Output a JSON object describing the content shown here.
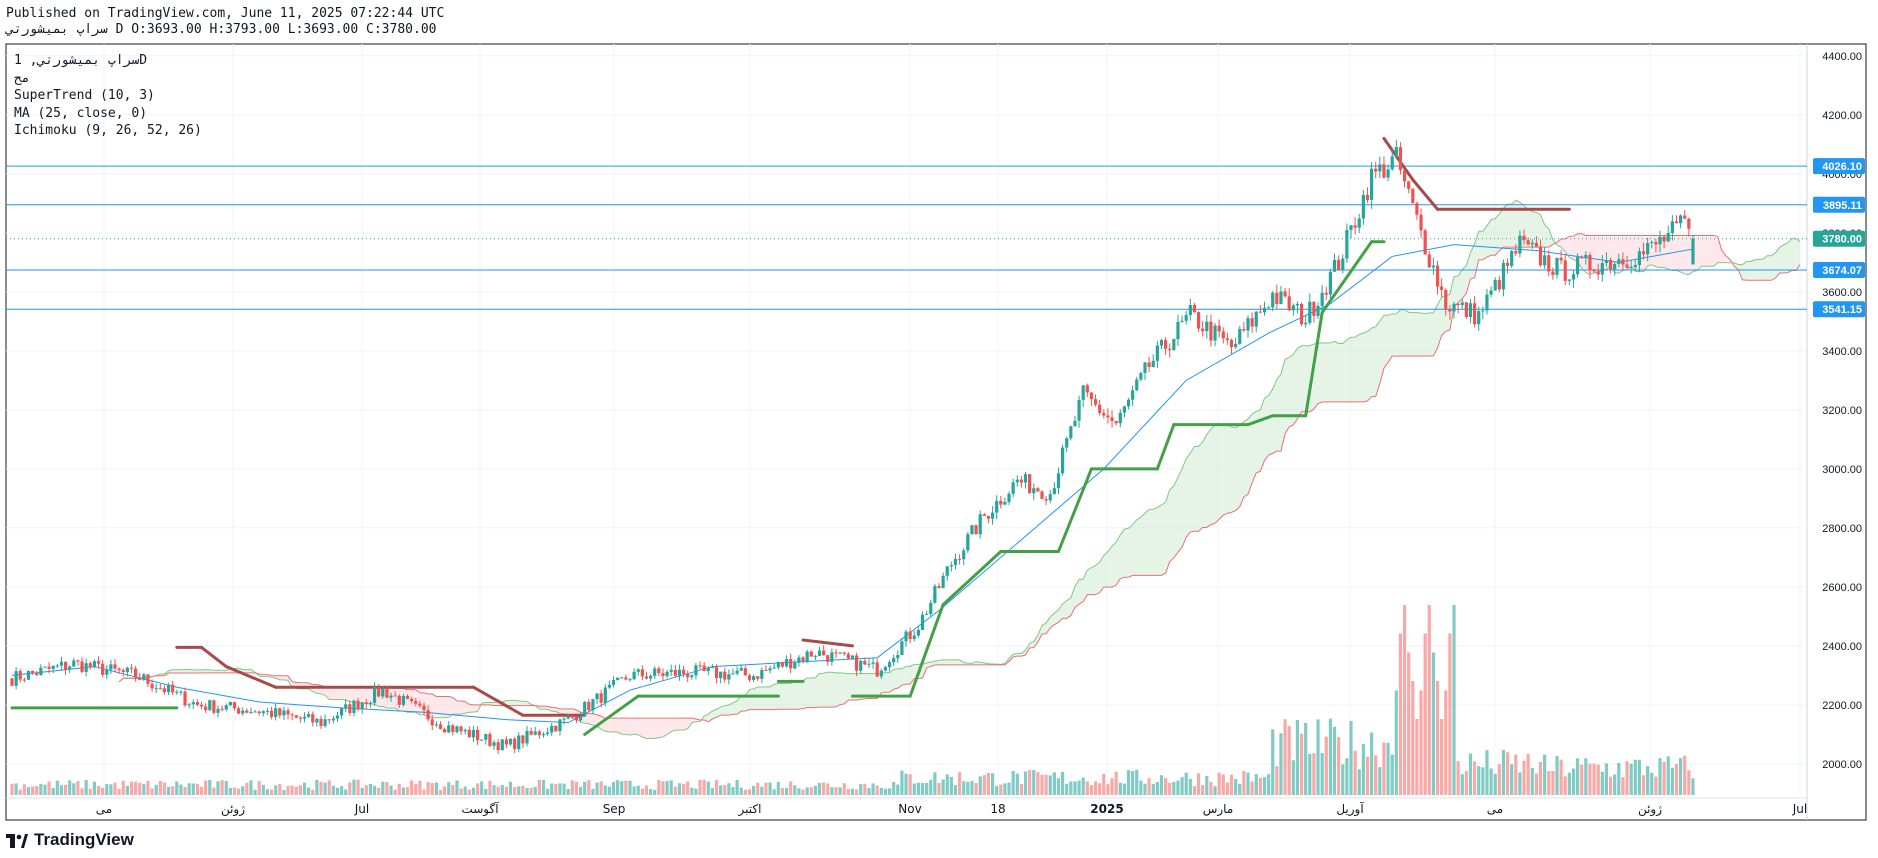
{
  "header": {
    "published": "Published on TradingView.com, June 11, 2025 07:22:44 UTC",
    "ohlc": "سراپ بمیشورتي D O:3693.00 H:3793.00 L:3693.00 C:3780.00"
  },
  "legend": {
    "symbol": "سراپ بمیشورتي, 1D",
    "exchange": "مح",
    "indicators": [
      "SuperTrend (10, 3)",
      "MA (25, close, 0)",
      "Ichimoku (9, 26, 52, 26)"
    ]
  },
  "brand": "TradingView",
  "colors": {
    "up": "#26a69a",
    "down": "#ef5350",
    "supertrend_up": "#43a047",
    "supertrend_down": "#a84a4a",
    "ma": "#2196f3",
    "cloud_bull": "#c8e6c9",
    "cloud_bear": "#ffcdd2",
    "hline": "#2196f3",
    "price_label": "#26a69a"
  },
  "chart_data": {
    "type": "candlestick",
    "y_axis": {
      "min": 1810,
      "max": 4440,
      "ticks": [
        2000,
        2200,
        2400,
        2600,
        2800,
        3000,
        3200,
        3400,
        3600,
        3800,
        4000,
        4200,
        4400
      ],
      "tick_labels": [
        "2000.00",
        "2200.00",
        "2400.00",
        "2600.00",
        "2800.00",
        "3000.00",
        "3200.00",
        "3400.00",
        "3600.00",
        "3800.00",
        "4000.00",
        "4200.00",
        "4400.00"
      ]
    },
    "x_axis": {
      "labels": [
        "می",
        "ژوئن",
        "Jul",
        "آگوست",
        "Sep",
        "اکتبر",
        "Nov",
        "18",
        "2025",
        "مارس",
        "آوریل",
        "می",
        "ژوئن",
        "Jul"
      ]
    },
    "horizontal_lines": [
      {
        "value": 4026.1,
        "label": "4026.10"
      },
      {
        "value": 3895.11,
        "label": "3895.11"
      },
      {
        "value": 3674.07,
        "label": "3674.07"
      },
      {
        "value": 3541.15,
        "label": "3541.15"
      }
    ],
    "last_price": {
      "value": 3780.0,
      "label": "3780.00"
    },
    "ohlc_last": {
      "open": 3693.0,
      "high": 3793.0,
      "low": 3693.0,
      "close": 3780.0
    },
    "close_path": [
      [
        0,
        2290
      ],
      [
        15,
        2340
      ],
      [
        30,
        2300
      ],
      [
        45,
        2200
      ],
      [
        60,
        2180
      ],
      [
        75,
        2140
      ],
      [
        90,
        2250
      ],
      [
        105,
        2130
      ],
      [
        120,
        2060
      ],
      [
        135,
        2150
      ],
      [
        150,
        2300
      ],
      [
        165,
        2310
      ],
      [
        180,
        2300
      ],
      [
        195,
        2380
      ],
      [
        210,
        2320
      ],
      [
        220,
        2470
      ],
      [
        228,
        2680
      ],
      [
        236,
        2840
      ],
      [
        244,
        2960
      ],
      [
        252,
        2920
      ],
      [
        260,
        3250
      ],
      [
        268,
        3150
      ],
      [
        276,
        3350
      ],
      [
        286,
        3520
      ],
      [
        296,
        3410
      ],
      [
        306,
        3590
      ],
      [
        314,
        3510
      ],
      [
        322,
        3700
      ],
      [
        330,
        3990
      ],
      [
        336,
        4050
      ],
      [
        342,
        3800
      ],
      [
        348,
        3560
      ],
      [
        356,
        3520
      ],
      [
        366,
        3760
      ],
      [
        376,
        3670
      ],
      [
        386,
        3700
      ],
      [
        396,
        3730
      ],
      [
        406,
        3830
      ],
      [
        408,
        3780
      ]
    ],
    "volume": [
      {
        "range": [
          0,
          215
        ],
        "level": 0.06
      },
      {
        "range": [
          216,
          305
        ],
        "level": 0.1
      },
      {
        "range": [
          306,
          335
        ],
        "level": 0.3
      },
      {
        "range": [
          336,
          350
        ],
        "level": 1.0
      },
      {
        "range": [
          351,
          370
        ],
        "level": 0.18
      },
      {
        "range": [
          371,
          408
        ],
        "level": 0.16
      }
    ],
    "supertrend": [
      [
        0,
        2190,
        "up"
      ],
      [
        40,
        2190,
        "up"
      ],
      [
        40,
        2395,
        "down"
      ],
      [
        46,
        2395,
        "down"
      ],
      [
        52,
        2330,
        "down"
      ],
      [
        64,
        2260,
        "down"
      ],
      [
        112,
        2260,
        "down"
      ],
      [
        124,
        2165,
        "down"
      ],
      [
        139,
        2165,
        "down"
      ],
      [
        139,
        2100,
        "up"
      ],
      [
        152,
        2230,
        "up"
      ],
      [
        186,
        2230,
        "up"
      ],
      [
        186,
        2280,
        "up"
      ],
      [
        192,
        2280,
        "up"
      ],
      [
        192,
        2420,
        "down"
      ],
      [
        204,
        2400,
        "down"
      ],
      [
        204,
        2230,
        "up"
      ],
      [
        218,
        2230,
        "up"
      ],
      [
        226,
        2540,
        "up"
      ],
      [
        240,
        2720,
        "up"
      ],
      [
        254,
        2720,
        "up"
      ],
      [
        262,
        3000,
        "up"
      ],
      [
        278,
        3000,
        "up"
      ],
      [
        282,
        3150,
        "up"
      ],
      [
        300,
        3150,
        "up"
      ],
      [
        306,
        3180,
        "up"
      ],
      [
        314,
        3180,
        "up"
      ],
      [
        318,
        3530,
        "up"
      ],
      [
        330,
        3770,
        "up"
      ],
      [
        333,
        3770,
        "up"
      ],
      [
        333,
        4120,
        "down"
      ],
      [
        340,
        3980,
        "down"
      ],
      [
        346,
        3880,
        "down"
      ],
      [
        378,
        3880,
        "down"
      ]
    ],
    "ma_path": [
      [
        0,
        2300
      ],
      [
        20,
        2330
      ],
      [
        40,
        2260
      ],
      [
        60,
        2210
      ],
      [
        80,
        2190
      ],
      [
        100,
        2175
      ],
      [
        120,
        2150
      ],
      [
        135,
        2140
      ],
      [
        150,
        2250
      ],
      [
        170,
        2330
      ],
      [
        190,
        2345
      ],
      [
        210,
        2360
      ],
      [
        225,
        2520
      ],
      [
        245,
        2760
      ],
      [
        265,
        3000
      ],
      [
        285,
        3300
      ],
      [
        305,
        3460
      ],
      [
        320,
        3560
      ],
      [
        335,
        3720
      ],
      [
        350,
        3760
      ],
      [
        370,
        3740
      ],
      [
        390,
        3700
      ],
      [
        408,
        3745
      ]
    ]
  }
}
